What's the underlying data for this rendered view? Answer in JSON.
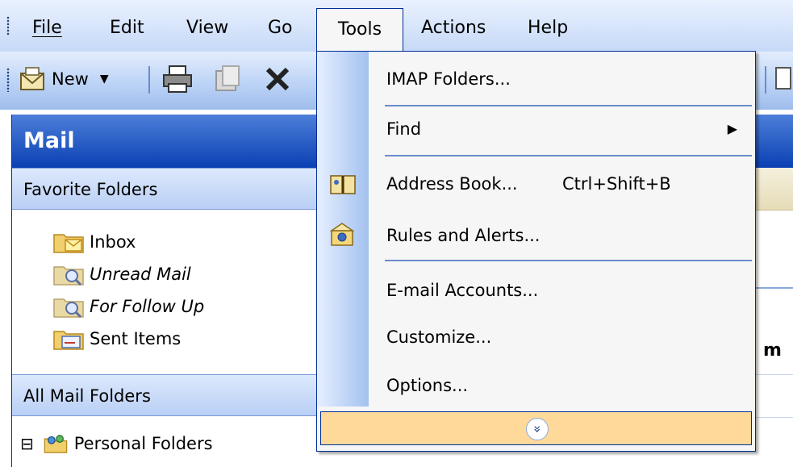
{
  "menubar": {
    "items": [
      {
        "label": "File"
      },
      {
        "label": "Edit"
      },
      {
        "label": "View"
      },
      {
        "label": "Go"
      },
      {
        "label": "Tools"
      },
      {
        "label": "Actions"
      },
      {
        "label": "Help"
      }
    ],
    "open_item": "Tools"
  },
  "toolbar": {
    "new_label": "New"
  },
  "navpane": {
    "title": "Mail",
    "favorites_header": "Favorite Folders",
    "favorites": [
      {
        "label": "Inbox"
      },
      {
        "label": "Unread Mail"
      },
      {
        "label": "For Follow Up"
      },
      {
        "label": "Sent Items"
      }
    ],
    "all_header": "All Mail Folders",
    "tree": [
      {
        "label": "Personal Folders",
        "toggle": "⊟"
      }
    ]
  },
  "rightpane": {
    "column_fragment": "m"
  },
  "tools_menu": {
    "items": [
      {
        "label": "IMAP Folders..."
      },
      {
        "label": "Find",
        "submenu": "▶"
      },
      {
        "label": "Address Book...",
        "shortcut": "Ctrl+Shift+B"
      },
      {
        "label": "Rules and Alerts..."
      },
      {
        "label": "E-mail Accounts..."
      },
      {
        "label": "Customize..."
      },
      {
        "label": "Options..."
      }
    ],
    "expand_glyph": "»"
  },
  "colors": {
    "accent": "#0a40b3",
    "menu_border": "#002d96",
    "highlight": "#ffd99a"
  }
}
